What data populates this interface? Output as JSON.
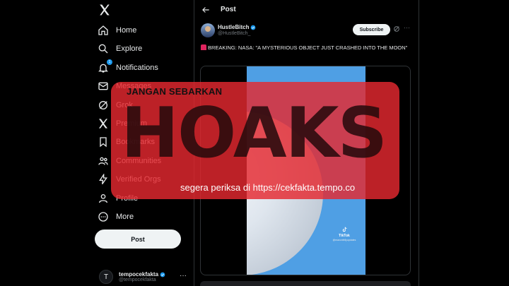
{
  "sidebar": {
    "nav": [
      {
        "label": "Home",
        "icon": "home-icon"
      },
      {
        "label": "Explore",
        "icon": "search-icon"
      },
      {
        "label": "Notifications",
        "icon": "bell-icon",
        "badge": "1"
      },
      {
        "label": "Messages",
        "icon": "mail-icon"
      },
      {
        "label": "Grok",
        "icon": "grok-icon"
      },
      {
        "label": "Premium",
        "icon": "x-icon"
      },
      {
        "label": "Bookmarks",
        "icon": "bookmark-icon"
      },
      {
        "label": "Communities",
        "icon": "people-icon"
      },
      {
        "label": "Verified Orgs",
        "icon": "lightning-icon"
      },
      {
        "label": "Profile",
        "icon": "person-icon"
      },
      {
        "label": "More",
        "icon": "more-circle-icon"
      }
    ],
    "post_button": "Post",
    "account": {
      "name": "tempocekfakta",
      "handle": "@tempocekfakta",
      "avatar_letter": "T"
    }
  },
  "header": {
    "title": "Post"
  },
  "post": {
    "author_name": "HustleBitch",
    "author_handle": "@HustleBitch_",
    "subscribe_label": "Subscribe",
    "more": "···",
    "text": "BREAKING: NASA: \"A MYSTERIOUS OBJECT JUST CRASHED INTO THE MOON\"",
    "media": {
      "watermark_label": "TikTok",
      "watermark_handle": "@maxonfellyupdates"
    }
  },
  "stamp": {
    "headline": "JANGAN SEBARKAN",
    "word": "HOAKS",
    "subline": "segera periksa di https://cekfakta.tempo.co"
  },
  "colors": {
    "accent": "#1d9bf0",
    "stamp_red": "#e52830",
    "background": "#000000"
  }
}
